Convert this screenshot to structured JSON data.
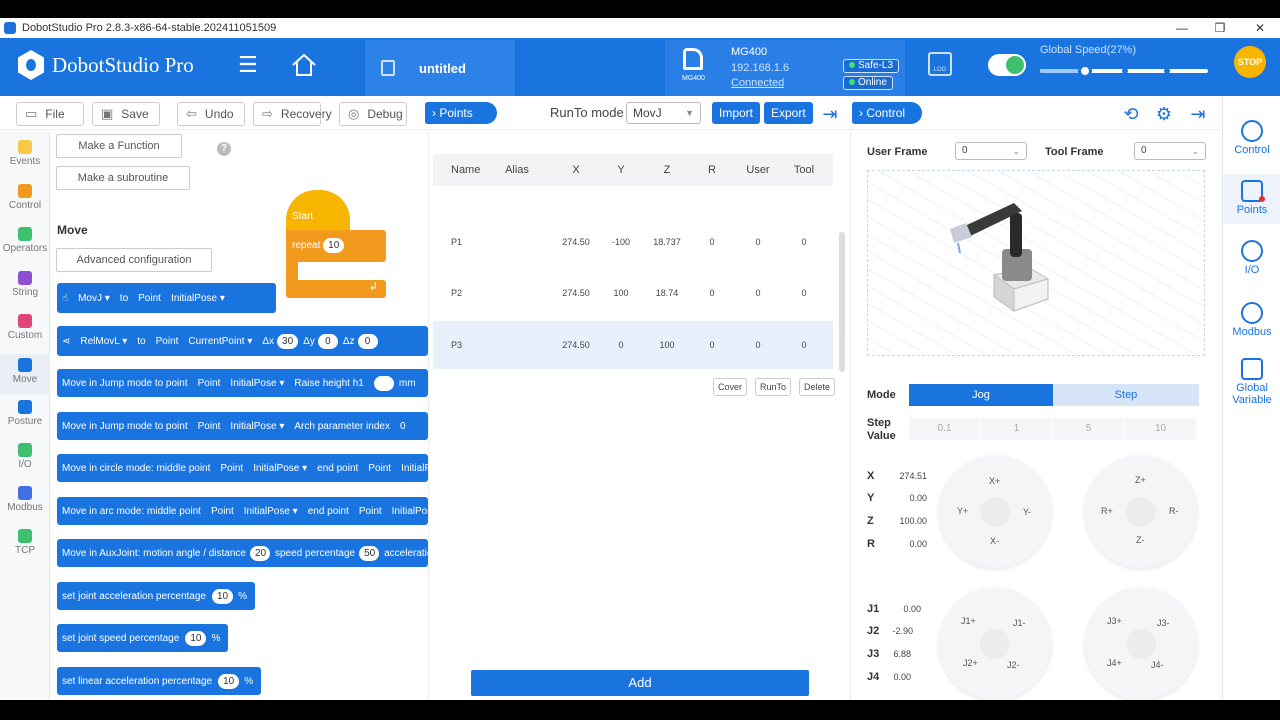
{
  "window": {
    "title": "DobotStudio Pro 2.8.3-x86-64-stable.202411051509",
    "minimize": "—",
    "maximize": "❐",
    "close": "✕"
  },
  "header": {
    "app_name": "DobotStudio Pro",
    "file_name": "untitled",
    "robot": {
      "icon_label": "MG400",
      "model": "MG400",
      "ip": "192.168.1.6",
      "status": "Connected",
      "safety": "Safe-L3",
      "online": "Online"
    },
    "log_label": "LOG",
    "speed_label": "Global Speed(27%)",
    "speed_fraction": 0.27,
    "stop_label": "STOP"
  },
  "toolbar": {
    "file": "File",
    "save": "Save",
    "undo": "Undo",
    "recovery": "Recovery",
    "debug": "Debug",
    "points": "Points",
    "runto_mode_label": "RunTo mode",
    "runto_mode_value": "MovJ",
    "import": "Import",
    "export": "Export",
    "control": "Control"
  },
  "left_nav": [
    {
      "label": "Events",
      "color": "#f7c948"
    },
    {
      "label": "Control",
      "color": "#f29a1d"
    },
    {
      "label": "Operators",
      "color": "#3fc06f"
    },
    {
      "label": "String",
      "color": "#8e4fd1"
    },
    {
      "label": "Custom",
      "color": "#e0457b"
    },
    {
      "label": "Move",
      "color": "#1a74e0"
    },
    {
      "label": "Posture",
      "color": "#1a74e0"
    },
    {
      "label": "I/O",
      "color": "#3fc06f"
    },
    {
      "label": "Modbus",
      "color": "#3f6fe0"
    },
    {
      "label": "TCP",
      "color": "#3fc06f"
    }
  ],
  "palette": {
    "make_function": "Make a Function",
    "make_subroutine": "Make a subroutine",
    "help": "?",
    "section": "Move",
    "advanced": "Advanced configuration",
    "blocks": {
      "movj": [
        "MovJ ▾",
        "to",
        "Point",
        "InitialPose ▾"
      ],
      "relmovl": [
        "RelMovL ▾",
        "to",
        "Point",
        "CurrentPoint ▾",
        "Δx",
        "30",
        "Δy",
        "0",
        "Δz",
        "0"
      ],
      "jump1": [
        "Move in Jump mode to point",
        "Point",
        "InitialPose ▾",
        "Raise height h1",
        "",
        "mm"
      ],
      "jump2": [
        "Move in Jump mode to point",
        "Point",
        "InitialPose ▾",
        "Arch parameter index",
        "0"
      ],
      "circle": [
        "Move in circle mode: middle point",
        "Point",
        "InitialPose ▾",
        "end point",
        "Point",
        "InitialPose"
      ],
      "arc": [
        "Move in arc mode: middle point",
        "Point",
        "InitialPose ▾",
        "end point",
        "Point",
        "InitialPose"
      ],
      "aux": [
        "Move in AuxJoint:  motion angle / distance",
        "20",
        "speed percentage",
        "50",
        "acceleration"
      ],
      "joint_acc": [
        "set joint acceleration percentage",
        "10",
        "%"
      ],
      "joint_speed": [
        "set joint speed percentage",
        "10",
        "%"
      ],
      "linear_acc": [
        "set linear acceleration percentage",
        "10",
        "%"
      ]
    },
    "canvas": {
      "start": "Start",
      "repeat": "repeat",
      "repeat_count": "10",
      "end_arrow": "↲"
    }
  },
  "points": {
    "columns": [
      "Name",
      "Alias",
      "X",
      "Y",
      "Z",
      "R",
      "User",
      "Tool"
    ],
    "rows": [
      [
        "P1",
        "",
        "274.50",
        "-100",
        "18.737",
        "0",
        "0",
        "0"
      ],
      [
        "P2",
        "",
        "274.50",
        "100",
        "18.74",
        "0",
        "0",
        "0"
      ],
      [
        "P3",
        "",
        "274.50",
        "0",
        "100",
        "0",
        "0",
        "0"
      ]
    ],
    "cover": "Cover",
    "runto": "RunTo",
    "delete": "Delete",
    "add": "Add"
  },
  "control": {
    "user_frame_label": "User Frame",
    "user_frame_value": "0",
    "tool_frame_label": "Tool Frame",
    "tool_frame_value": "0",
    "mode_label": "Mode",
    "mode_jog": "Jog",
    "mode_step": "Step",
    "step_label": "Step Value",
    "steps": [
      "0.1",
      "1",
      "5",
      "10"
    ],
    "coords": [
      {
        "k": "X",
        "v": "274.51"
      },
      {
        "k": "Y",
        "v": "0.00"
      },
      {
        "k": "Z",
        "v": "100.00"
      },
      {
        "k": "R",
        "v": "0.00"
      }
    ],
    "joints": [
      {
        "k": "J1",
        "v": "0.00"
      },
      {
        "k": "J2",
        "v": "-2.90"
      },
      {
        "k": "J3",
        "v": "6.88"
      },
      {
        "k": "J4",
        "v": "0.00"
      }
    ],
    "pad_xy": {
      "up": "X+",
      "down": "X-",
      "left": "Y+",
      "right": "Y-"
    },
    "pad_zr": {
      "up": "Z+",
      "down": "Z-",
      "left": "R+",
      "right": "R-"
    },
    "pad_j12": {
      "a": "J1+",
      "b": "J1-",
      "c": "J2+",
      "d": "J2-"
    },
    "pad_j34": {
      "a": "J3+",
      "b": "J3-",
      "c": "J4+",
      "d": "J4-"
    }
  },
  "right_rail": [
    {
      "label": "Control"
    },
    {
      "label": "Points"
    },
    {
      "label": "I/O"
    },
    {
      "label": "Modbus"
    },
    {
      "label": "Global Variable"
    }
  ]
}
